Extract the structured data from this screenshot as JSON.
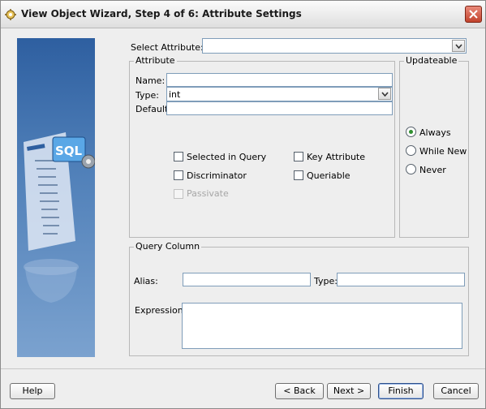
{
  "window": {
    "title": "View Object Wizard, Step 4 of 6: Attribute Settings"
  },
  "select_attribute": {
    "label": "Select Attribute:",
    "value": ""
  },
  "attribute_group": {
    "title": "Attribute",
    "name_label": "Name:",
    "name_value": "",
    "type_label": "Type:",
    "type_value": "int",
    "default_label": "Default:",
    "default_value": "",
    "checkboxes": {
      "selected_in_query": "Selected in Query",
      "key_attribute": "Key Attribute",
      "discriminator": "Discriminator",
      "queriable": "Queriable",
      "passivate": "Passivate"
    }
  },
  "updateable_group": {
    "title": "Updateable",
    "options": [
      "Always",
      "While New",
      "Never"
    ],
    "selected": "Always"
  },
  "query_column_group": {
    "title": "Query Column",
    "alias_label": "Alias:",
    "alias_value": "",
    "type_label": "Type:",
    "type_value": "",
    "expression_label": "Expression:",
    "expression_value": ""
  },
  "side_image": {
    "sql_badge": "SQL"
  },
  "buttons": {
    "help": "Help",
    "back": "< Back",
    "next": "Next >",
    "finish": "Finish",
    "cancel": "Cancel"
  }
}
